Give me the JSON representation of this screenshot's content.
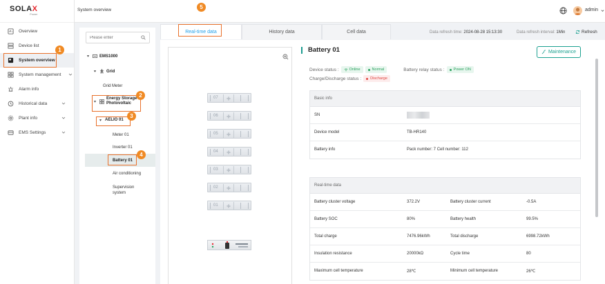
{
  "logo": {
    "brand": "SOLA",
    "brand_x": "X",
    "sub": "Power"
  },
  "sidebar": {
    "items": [
      {
        "label": "Overview",
        "icon": "overview-icon"
      },
      {
        "label": "Device list",
        "icon": "device-list-icon"
      },
      {
        "label": "System overview",
        "icon": "system-overview-icon",
        "active": true
      },
      {
        "label": "System management",
        "icon": "system-management-icon"
      },
      {
        "label": "Alarm info",
        "icon": "alarm-icon"
      },
      {
        "label": "Historical data",
        "icon": "historical-data-icon"
      },
      {
        "label": "Plant info",
        "icon": "plant-info-icon"
      },
      {
        "label": "EMS Settings",
        "icon": "ems-settings-icon"
      }
    ]
  },
  "header": {
    "title": "System overview",
    "user": "admin"
  },
  "tree": {
    "search_placeholder": "Please enter",
    "ems": "EMS1000",
    "grid": "Grid",
    "grid_meter": "Grid Meter",
    "ess": "Energy Storage Photovoltaic",
    "aelio": "AELIO 01",
    "meter": "Meter 01",
    "inverter": "Inverter 01",
    "battery": "Battery 01",
    "aircon": "Air conditioning",
    "supervision": "Supervision system"
  },
  "tabs": {
    "realtime": "Real-time data",
    "history": "History data",
    "cell": "Cell data"
  },
  "refresh": {
    "time_label": "Data refresh time:",
    "time_value": "2024-08-28 15:13:30",
    "interval_label": "Data refresh interval:",
    "interval_value": "1Min",
    "button": "Refresh"
  },
  "rack": {
    "modules": [
      "07",
      "06",
      "05",
      "04",
      "03",
      "02",
      "01"
    ]
  },
  "detail": {
    "title": "Battery 01",
    "maintenance": "Maintenance",
    "device_status_label": "Device status :",
    "online": "Online",
    "normal": "Normal",
    "relay_label": "Battery relay status :",
    "relay_value": "Power ON",
    "charge_label": "Charge/Discharge status :",
    "charge_value": "Discharge"
  },
  "basic_info": {
    "heading": "Basic info",
    "sn_label": "SN",
    "model_label": "Device model",
    "model_value": "TB-HR140",
    "info_label": "Battery info",
    "info_value": "Pack number: 7 Cell number: 112"
  },
  "realtime": {
    "heading": "Real-time data",
    "rows": [
      {
        "l1": "Battery cluster voltage",
        "v1": "372.2V",
        "l2": "Battery cluster current",
        "v2": "-0.5A"
      },
      {
        "l1": "Battery SOC",
        "v1": "80%",
        "l2": "Battery health",
        "v2": "99.5%"
      },
      {
        "l1": "Total charge",
        "v1": "7476.96kWh",
        "l2": "Total discharge",
        "v2": "6998.72kWh"
      },
      {
        "l1": "Insulation resistance",
        "v1": "20000kΩ",
        "l2": "Cycle time",
        "v2": "80"
      },
      {
        "l1": "Maximum cell temperature",
        "v1": "28℃",
        "l2": "Minimum cell temperature",
        "v2": "26℃"
      }
    ]
  },
  "badges": [
    "1",
    "2",
    "3",
    "4",
    "5"
  ],
  "colors": {
    "accent": "#1aa08f",
    "tab_active": "#1f9ee8",
    "highlight": "#e8702a",
    "badge": "#f08a24"
  }
}
